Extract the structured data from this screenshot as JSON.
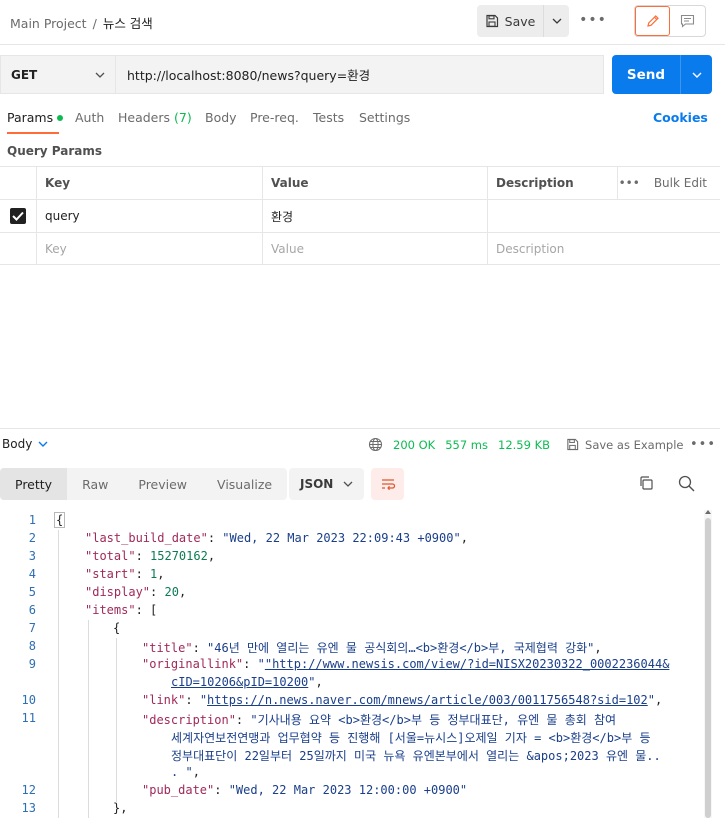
{
  "header": {
    "breadcrumb_parent": "Main Project",
    "breadcrumb_sep": "/",
    "breadcrumb_current": "뉴스 검색",
    "save_label": "Save",
    "more_label": "•••"
  },
  "request": {
    "method": "GET",
    "url": "http://localhost:8080/news?query=환경",
    "send_label": "Send"
  },
  "tabs": {
    "params": "Params",
    "auth": "Auth",
    "headers": "Headers",
    "headers_count": "(7)",
    "body": "Body",
    "prereq": "Pre-req.",
    "tests": "Tests",
    "settings": "Settings",
    "cookies": "Cookies"
  },
  "params": {
    "title": "Query Params",
    "col_key": "Key",
    "col_value": "Value",
    "col_description": "Description",
    "bulk_more": "•••",
    "bulk_edit": "Bulk Edit",
    "rows": [
      {
        "checked": true,
        "key": "query",
        "value": "환경",
        "description": ""
      }
    ],
    "placeholder_key": "Key",
    "placeholder_value": "Value",
    "placeholder_description": "Description"
  },
  "response": {
    "body_label": "Body",
    "status": "200 OK",
    "time": "557 ms",
    "size": "12.59 KB",
    "save_example": "Save as Example",
    "more_label": "•••",
    "view_tabs": [
      "Pretty",
      "Raw",
      "Preview",
      "Visualize"
    ],
    "format": "JSON"
  },
  "code": {
    "line_numbers": [
      "1",
      "2",
      "3",
      "4",
      "5",
      "6",
      "7",
      "8",
      "9",
      "10",
      "11",
      "12",
      "13"
    ],
    "open_brace": "{",
    "k_last_build_date": "\"last_build_date\"",
    "v_last_build_date": "\"Wed, 22 Mar 2023 22:09:43 +0900\"",
    "k_total": "\"total\"",
    "v_total": "15270162",
    "k_start": "\"start\"",
    "v_start": "1",
    "k_display": "\"display\"",
    "v_display": "20",
    "k_items": "\"items\"",
    "items_open": "[",
    "item_open": "{",
    "k_title": "\"title\"",
    "v_title": "\"46년 만에 열리는 유엔 물 공식회의…<b>환경</b>부, 국제협력 강화\"",
    "k_originallink": "\"originallink\"",
    "v_originallink_1": "\"http://www.newsis.com/view/?id=NISX20230322_0002236044&",
    "v_originallink_2": "cID=10206&pID=10200",
    "v_originallink_3": "\"",
    "k_link": "\"link\"",
    "v_link_url": "https://n.news.naver.com/mnews/article/003/0011756548?sid=102",
    "k_description": "\"description\"",
    "v_description_1": "\"기사내용 요약 <b>환경</b>부 등 정부대표단, 유엔 물 총회 참여",
    "v_description_2": "세계자연보전연맹과 업무협약 등 진행해 [서울=뉴시스]오제일 기자 = <b>환경</b>부 등",
    "v_description_3": "정부대표단이 22일부터 25일까지 미국 뉴욕 유엔본부에서 열리는 &apos;2023 유엔 물..",
    "v_description_4": ". \"",
    "k_pub_date": "\"pub_date\"",
    "v_pub_date": "\"Wed, 22 Mar 2023 12:00:00 +0900\"",
    "item_close": "},"
  }
}
